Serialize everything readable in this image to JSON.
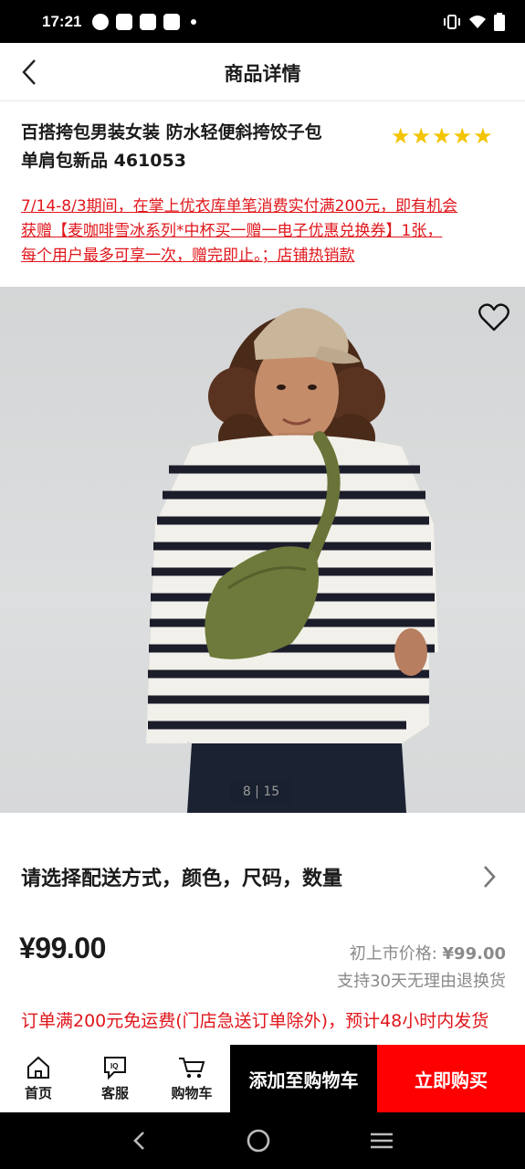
{
  "status_bar": {
    "time": "17:21",
    "left_icons": [
      "speed-icon",
      "mail-icon",
      "mail-icon",
      "mail-icon",
      "dot-icon"
    ],
    "right_icons": [
      "vibrate-icon",
      "wifi-icon",
      "battery-icon"
    ]
  },
  "header": {
    "title": "商品详情",
    "back_icon": "chevron-left-icon"
  },
  "product": {
    "title_line1": "百搭挎包男装女装 防水轻便斜挎饺子包",
    "title_line2": "单肩包新品 461053",
    "rating_stars": 5,
    "promo_line1": "7/14-8/3期间，在掌上优衣库单笔消费实付满200元，即有机会",
    "promo_line2": "获赠【麦咖啡雪冰系列*中杯买一赠一电子优惠兑换券】1张，",
    "promo_line3": "每个用户最多可享一次，赠完即止。；店铺热销款",
    "image_indicator": "8 | 15"
  },
  "options": {
    "label": "请选择配送方式，颜色，尺码，数量"
  },
  "pricing": {
    "price": "¥99.00",
    "original_label": "初上市价格: ",
    "original_price": "¥99.00",
    "return_note": "支持30天无理由退换货",
    "shipping_note": "订单满200元免运费(门店急送订单除外)，预计48小时内发货"
  },
  "bottom_nav": {
    "home": "首页",
    "service": "客服",
    "cart": "购物车",
    "add_to_cart": "添加至购物车",
    "buy_now": "立即购买"
  },
  "colors": {
    "accent_red": "#ff0000",
    "promo_red": "#e0161b",
    "star_yellow": "#f3c400"
  }
}
